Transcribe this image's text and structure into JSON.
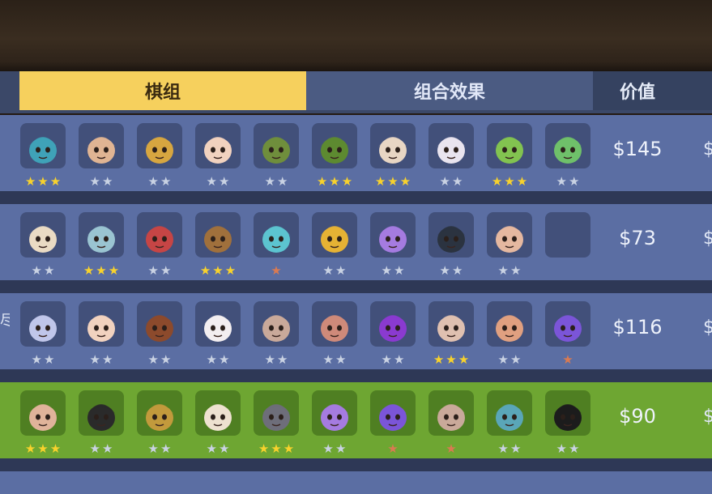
{
  "tabs": {
    "active": "棋组",
    "inactive": "组合效果",
    "value": "价值"
  },
  "rows": [
    {
      "price": "$145",
      "slots": [
        {
          "icon": "mech-goggle-hero-icon",
          "stars": 3,
          "tier": "gold",
          "face": "#3fa2b8"
        },
        {
          "icon": "white-turban-hero-icon",
          "stars": 2,
          "tier": "silver",
          "face": "#e0b493"
        },
        {
          "icon": "golden-hood-hero-icon",
          "stars": 2,
          "tier": "silver",
          "face": "#d7a640"
        },
        {
          "icon": "white-hair-girl-hero-icon",
          "stars": 2,
          "tier": "silver",
          "face": "#f1d2bf"
        },
        {
          "icon": "green-goblin-hero-icon",
          "stars": 2,
          "tier": "silver",
          "face": "#6f8e3c"
        },
        {
          "icon": "orc-warrior-hero-icon",
          "stars": 3,
          "tier": "gold",
          "face": "#5d8a30"
        },
        {
          "icon": "white-beard-elder-hero-icon",
          "stars": 3,
          "tier": "gold",
          "face": "#e8d6c4"
        },
        {
          "icon": "white-mask-hero-icon",
          "stars": 2,
          "tier": "silver",
          "face": "#e9e4ef"
        },
        {
          "icon": "red-cap-goblin-hero-icon",
          "stars": 3,
          "tier": "gold",
          "face": "#82c350"
        },
        {
          "icon": "bandana-goblin-hero-icon",
          "stars": 2,
          "tier": "silver",
          "face": "#6fc06a"
        }
      ]
    },
    {
      "price": "$73",
      "slots": [
        {
          "icon": "bearded-sage-hero-icon",
          "stars": 2,
          "tier": "silver",
          "face": "#eadbc4"
        },
        {
          "icon": "armored-beast-hero-icon",
          "stars": 3,
          "tier": "gold",
          "face": "#9ac4d1"
        },
        {
          "icon": "crimson-mask-hero-icon",
          "stars": 2,
          "tier": "silver",
          "face": "#c64545"
        },
        {
          "icon": "wooden-totem-hero-icon",
          "stars": 3,
          "tier": "gold",
          "face": "#a0703c"
        },
        {
          "icon": "twin-spirits-hero-icon",
          "stars": 1,
          "tier": "bronze",
          "face": "#5cc4d0"
        },
        {
          "icon": "golden-helm-hero-icon",
          "stars": 2,
          "tier": "silver",
          "face": "#e6b234"
        },
        {
          "icon": "purple-hair-hero-icon",
          "stars": 2,
          "tier": "silver",
          "face": "#a57be0"
        },
        {
          "icon": "shield-robot-hero-icon",
          "stars": 2,
          "tier": "silver",
          "face": "#2b3340"
        },
        {
          "icon": "brawler-hero-icon",
          "stars": 2,
          "tier": "silver",
          "face": "#e5b8a0"
        },
        {
          "icon": "empty-slot-icon",
          "stars": 0,
          "tier": "none",
          "face": "none"
        }
      ]
    },
    {
      "price": "$116",
      "slots": [
        {
          "icon": "pale-ghost-hero-icon",
          "stars": 2,
          "tier": "silver",
          "face": "#c0c6ea"
        },
        {
          "icon": "white-hair-girl-hero-icon",
          "stars": 2,
          "tier": "silver",
          "face": "#f1d2bf"
        },
        {
          "icon": "pirate-hero-icon",
          "stars": 2,
          "tier": "silver",
          "face": "#8c4a2c"
        },
        {
          "icon": "panda-girl-hero-icon",
          "stars": 2,
          "tier": "silver",
          "face": "#f3eef0"
        },
        {
          "icon": "stone-golem-hero-icon",
          "stars": 2,
          "tier": "silver",
          "face": "#c9a99a"
        },
        {
          "icon": "skull-mask-hero-icon",
          "stars": 2,
          "tier": "silver",
          "face": "#cf8a7a"
        },
        {
          "icon": "purple-horned-hero-icon",
          "stars": 2,
          "tier": "silver",
          "face": "#8a3ad0"
        },
        {
          "icon": "bandaged-brute-hero-icon",
          "stars": 3,
          "tier": "gold",
          "face": "#dfc0b0"
        },
        {
          "icon": "pilot-goggles-hero-icon",
          "stars": 2,
          "tier": "silver",
          "face": "#e0a080"
        },
        {
          "icon": "purple-knight-hero-icon",
          "stars": 1,
          "tier": "bronze",
          "face": "#7b55d8"
        }
      ]
    },
    {
      "price": "$90",
      "highlight": true,
      "slots": [
        {
          "icon": "goggle-dwarf-hero-icon",
          "stars": 3,
          "tier": "gold",
          "face": "#e0b39a"
        },
        {
          "icon": "dark-hair-hero-icon",
          "stars": 2,
          "tier": "silver",
          "face": "#2a2a2a"
        },
        {
          "icon": "golden-hood-girl-hero-icon",
          "stars": 2,
          "tier": "silver",
          "face": "#c29a3c"
        },
        {
          "icon": "pale-mask-hero-icon",
          "stars": 2,
          "tier": "silver",
          "face": "#eee1d0"
        },
        {
          "icon": "hooded-elf-hero-icon",
          "stars": 3,
          "tier": "gold",
          "face": "#6e6e7a"
        },
        {
          "icon": "purple-hair-hero-icon",
          "stars": 2,
          "tier": "silver",
          "face": "#a57be0"
        },
        {
          "icon": "purple-knight-hero-icon",
          "stars": 1,
          "tier": "bronze",
          "face": "#7b55d8"
        },
        {
          "icon": "stone-golem-hero-icon",
          "stars": 1,
          "tier": "bronze",
          "face": "#c9a99a"
        },
        {
          "icon": "horned-viking-hero-icon",
          "stars": 2,
          "tier": "silver",
          "face": "#5aa6b8"
        },
        {
          "icon": "shadow-hood-hero-icon",
          "stars": 2,
          "tier": "silver",
          "face": "#1c1c1c"
        }
      ]
    }
  ],
  "left_edge_glyph": "尽",
  "right_edge_glyph": "$"
}
